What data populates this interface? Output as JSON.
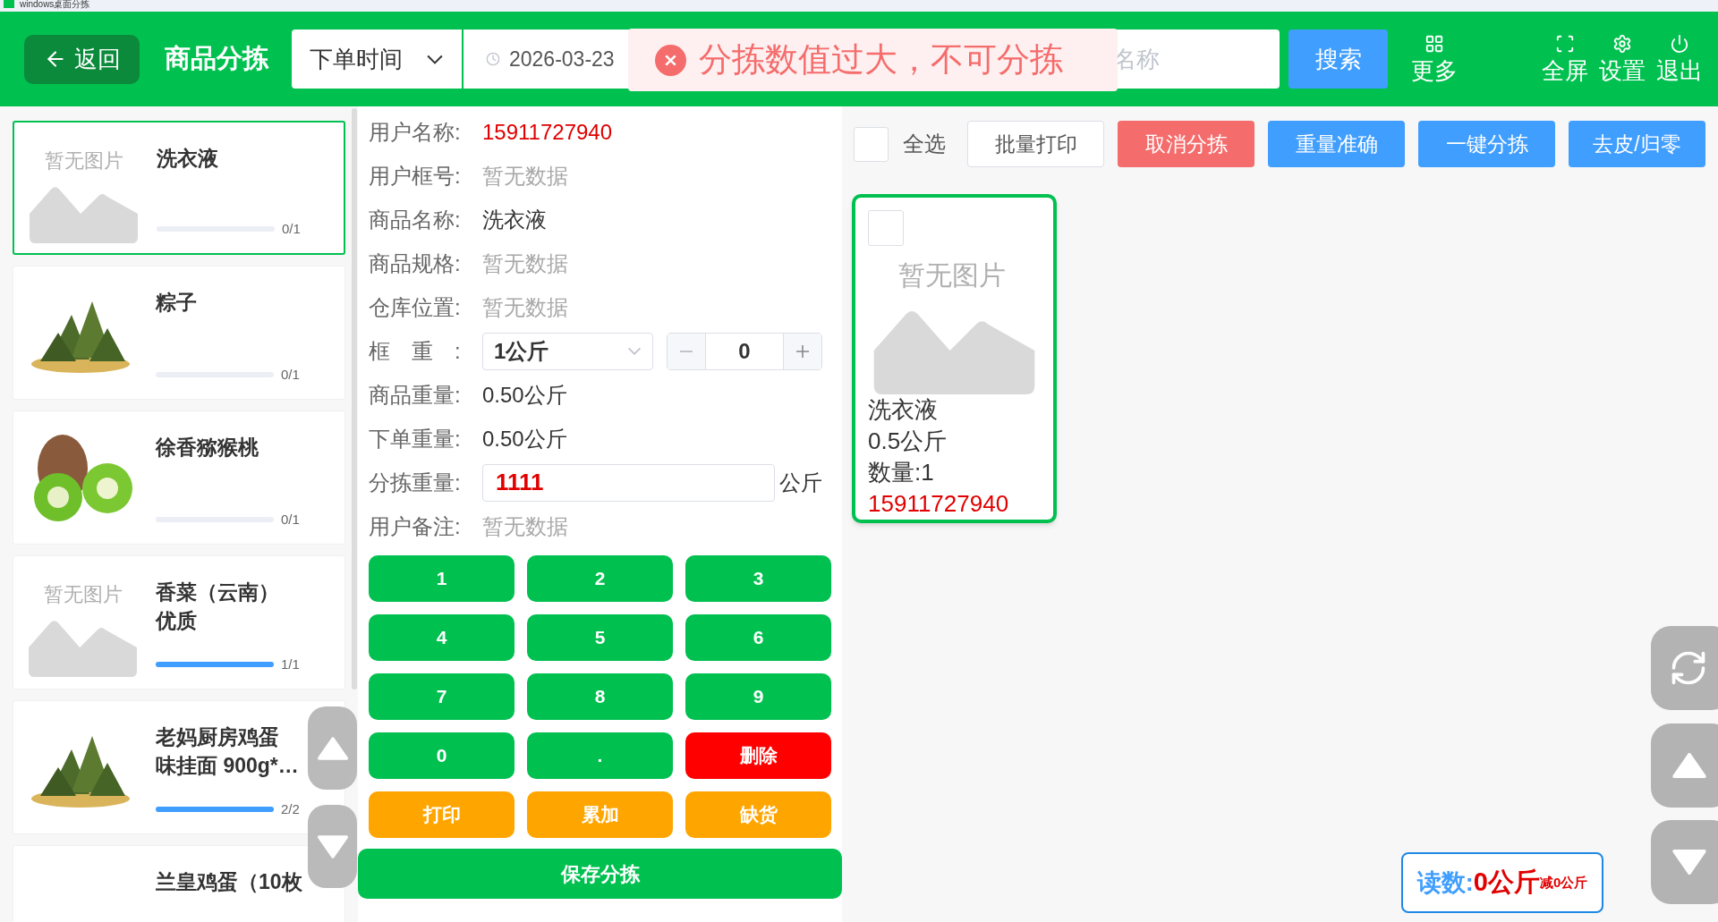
{
  "window": {
    "title": "windows桌面分拣"
  },
  "header": {
    "back_button": "返回",
    "title": "商品分拣",
    "date_type": {
      "value": "下单时间"
    },
    "date_field": {
      "value": "2026-03-23"
    },
    "search_field": {
      "placeholder": "名称"
    },
    "search_button": "搜索",
    "actions": [
      {
        "kind": "grid",
        "label": "更多"
      },
      {
        "kind": "fullscreen",
        "label": "全屏"
      },
      {
        "kind": "settings",
        "label": "设置"
      },
      {
        "kind": "power",
        "label": "退出"
      }
    ]
  },
  "toast": {
    "message": "分拣数值过大，不可分拣"
  },
  "products": [
    {
      "name": "洗衣液",
      "kind": "placeholder",
      "no_image_text": "暂无图片",
      "level": 0,
      "count": "0/1",
      "selected": true
    },
    {
      "name": "粽子",
      "kind": "picture",
      "level": 0,
      "count": "0/1",
      "selected": false
    },
    {
      "name": "徐香猕猴桃",
      "kind": "picture",
      "level": 0,
      "count": "0/1",
      "selected": false
    },
    {
      "name": "香菜（云南）优质",
      "kind": "placeholder",
      "no_image_text": "暂无图片",
      "level": 1,
      "count": "1/1",
      "selected": false
    },
    {
      "name": "老妈厨房鸡蛋味挂面 900g*…",
      "kind": "picture",
      "level": 1,
      "count": "2/2",
      "selected": false
    },
    {
      "name": "兰皇鸡蛋（10枚",
      "selected": false
    }
  ],
  "detail": {
    "rows": [
      {
        "kind": "alert",
        "label": "用户名称:",
        "value": "15911727940"
      },
      {
        "kind": "empty",
        "label": "用户框号:",
        "value": "暂无数据"
      },
      {
        "kind": "text",
        "label": "商品名称:",
        "value": "洗衣液"
      },
      {
        "kind": "empty",
        "label": "商品规格:",
        "value": "暂无数据"
      },
      {
        "kind": "empty",
        "label": "仓库位置:",
        "value": "暂无数据"
      },
      {
        "kind": "frame",
        "label": "框　重　:",
        "value": "1公斤",
        "stepper": "0"
      },
      {
        "kind": "text",
        "label": "商品重量:",
        "value": "0.50公斤"
      },
      {
        "kind": "text",
        "label": "下单重量:",
        "value": "0.50公斤"
      },
      {
        "kind": "input",
        "label": "分拣重量:",
        "value": "1111",
        "unit": "公斤"
      },
      {
        "kind": "empty",
        "label": "用户备注:",
        "value": "暂无数据"
      }
    ]
  },
  "keypad": [
    {
      "label": "1",
      "kind": "digit"
    },
    {
      "label": "2",
      "kind": "digit"
    },
    {
      "label": "3",
      "kind": "digit"
    },
    {
      "label": "4",
      "kind": "digit"
    },
    {
      "label": "5",
      "kind": "digit"
    },
    {
      "label": "6",
      "kind": "digit"
    },
    {
      "label": "7",
      "kind": "digit"
    },
    {
      "label": "8",
      "kind": "digit"
    },
    {
      "label": "9",
      "kind": "digit"
    },
    {
      "label": "0",
      "kind": "digit"
    },
    {
      "label": ".",
      "kind": "digit"
    },
    {
      "label": "删除",
      "kind": "delete"
    },
    {
      "label": "打印",
      "kind": "action"
    },
    {
      "label": "累加",
      "kind": "action"
    },
    {
      "label": "缺货",
      "kind": "action"
    }
  ],
  "save_button": "保存分拣",
  "toolbar": {
    "select_all": {
      "label": "全选",
      "checked": false
    },
    "buttons": [
      {
        "label": "批量打印",
        "kind": "plain"
      },
      {
        "label": "取消分拣",
        "kind": "danger"
      },
      {
        "label": "重量准确",
        "kind": "primary"
      },
      {
        "label": "一键分拣",
        "kind": "primary"
      },
      {
        "label": "去皮/归零",
        "kind": "primary"
      }
    ]
  },
  "orders": [
    {
      "checked": false,
      "selected": true,
      "no_image_text": "暂无图片",
      "name": "洗衣液",
      "spec": "0.5公斤",
      "quantity": "数量:1",
      "user": "15911727940"
    }
  ],
  "reading": {
    "label": "读数:",
    "value": "0公斤",
    "tare": "减0公斤"
  }
}
